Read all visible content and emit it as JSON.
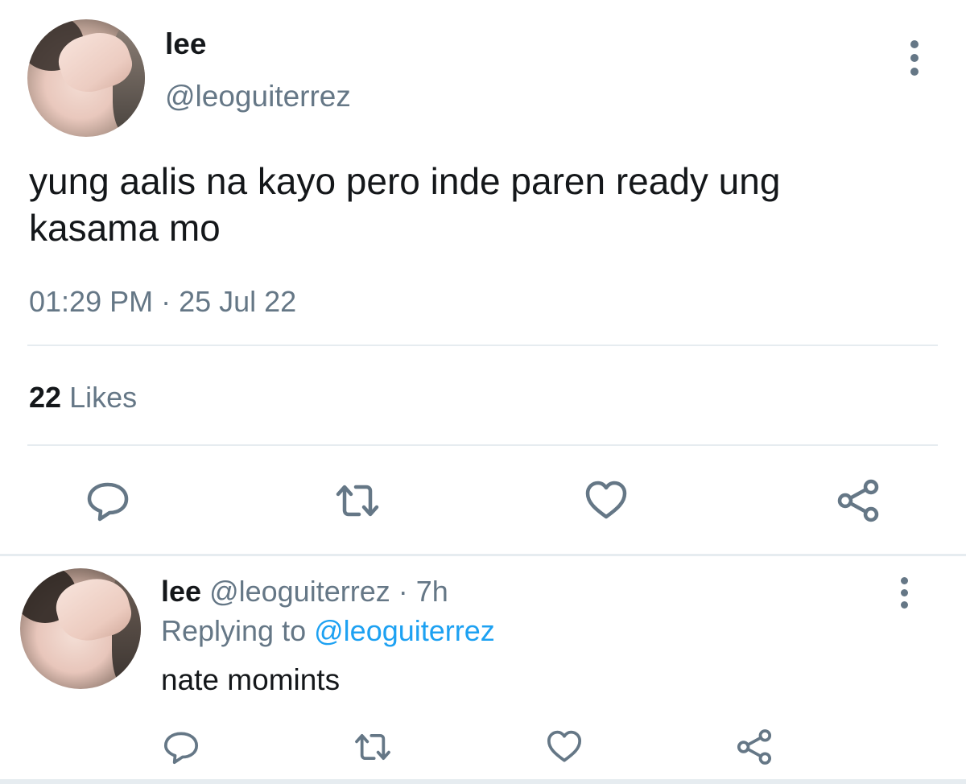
{
  "tweet": {
    "name": "lee",
    "handle": "@leoguiterrez",
    "text": "yung aalis na kayo pero inde paren ready ung kasama mo",
    "timestamp": "01:29 PM · 25 Jul 22",
    "likes_count": "22",
    "likes_label": "Likes",
    "actions": [
      "reply-icon",
      "retweet-icon",
      "like-icon",
      "share-icon"
    ]
  },
  "reply": {
    "name": "lee",
    "handle": "@leoguiterrez",
    "age": "· 7h",
    "replying_prefix": "Replying to",
    "replying_to": "@leoguiterrez",
    "text": "nate momints"
  },
  "colors": {
    "primary_text": "#14171a",
    "secondary_text": "#657786",
    "link": "#1da1f2",
    "divider": "#e6ecf0"
  }
}
